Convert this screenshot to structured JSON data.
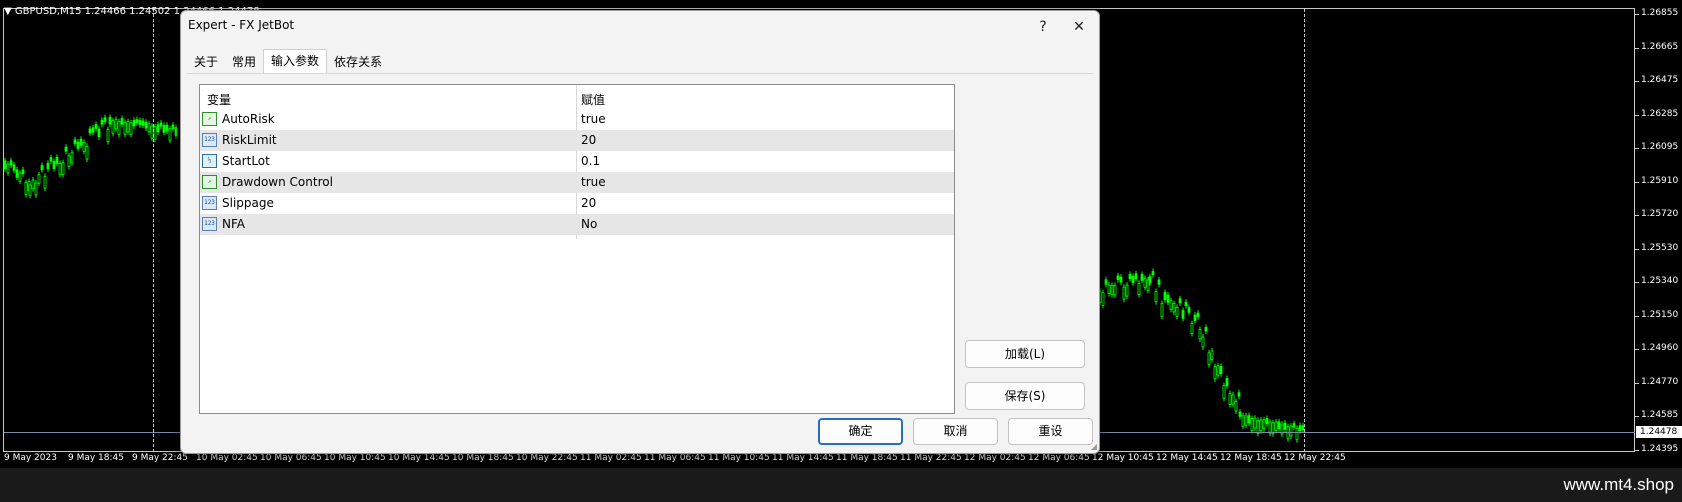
{
  "chart": {
    "symbol_header": "GBPUSD,M15  1.24466 1.24502 1.24466 1.24478",
    "current_price": "1.24478",
    "price_ticks": [
      "1.26855",
      "1.26665",
      "1.26475",
      "1.26285",
      "1.26095",
      "1.25910",
      "1.25720",
      "1.25530",
      "1.25340",
      "1.25150",
      "1.24960",
      "1.24770",
      "1.24585",
      "1.24395"
    ],
    "time_labels": [
      "9 May 2023",
      "9 May 18:45",
      "9 May 22:45",
      "10 May 02:45",
      "10 May 06:45",
      "10 May 10:45",
      "10 May 14:45",
      "10 May 18:45",
      "10 May 22:45",
      "11 May 02:45",
      "11 May 06:45",
      "11 May 10:45",
      "11 May 14:45",
      "11 May 18:45",
      "11 May 22:45",
      "12 May 02:45",
      "12 May 06:45",
      "12 May 10:45",
      "12 May 14:45",
      "12 May 18:45",
      "12 May 22:45"
    ],
    "candle_color": "#00ff00"
  },
  "watermark": "www.mt4.shop",
  "dialog": {
    "title": "Expert - FX JetBot",
    "help_label": "?",
    "close_label": "✕",
    "tabs": [
      {
        "label": "关于",
        "active": false
      },
      {
        "label": "常用",
        "active": false
      },
      {
        "label": "输入参数",
        "active": true
      },
      {
        "label": "依存关系",
        "active": false
      }
    ],
    "grid": {
      "col_variable": "变量",
      "col_value": "赋值",
      "rows": [
        {
          "name": "AutoRisk",
          "value": "true",
          "icon": "bool-icon",
          "icon_text": "↗"
        },
        {
          "name": "RiskLimit",
          "value": "20",
          "icon": "int-icon",
          "icon_text": "123"
        },
        {
          "name": "StartLot",
          "value": "0.1",
          "icon": "double-icon",
          "icon_text": "½"
        },
        {
          "name": "Drawdown Control",
          "value": "true",
          "icon": "bool-icon",
          "icon_text": "↗"
        },
        {
          "name": "Slippage",
          "value": "20",
          "icon": "int-icon",
          "icon_text": "123"
        },
        {
          "name": "NFA",
          "value": "No",
          "icon": "int-icon",
          "icon_text": "123"
        }
      ]
    },
    "load_button": "加载(L)",
    "save_button": "保存(S)",
    "ok_button": "确定",
    "cancel_button": "取消",
    "reset_button": "重设"
  }
}
